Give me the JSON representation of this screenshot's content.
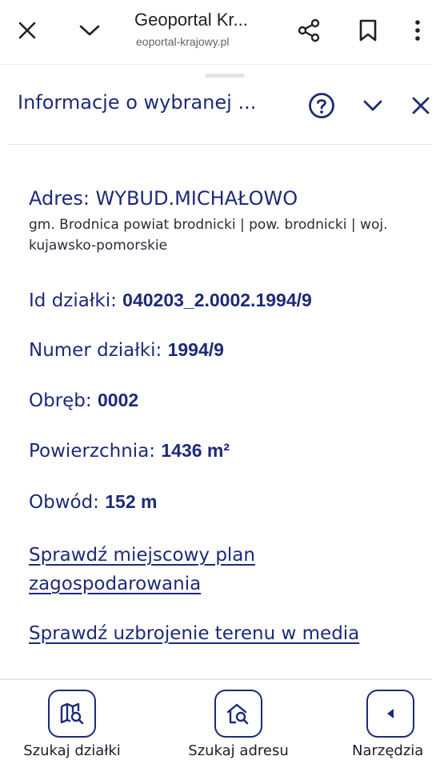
{
  "browser": {
    "title": "Geoportal Kr...",
    "url": "eoportal-krajowy.pl"
  },
  "panel": {
    "title": "Informacje o wybranej ..."
  },
  "parcel": {
    "address_label": "Adres: WYBUD.MICHAŁOWO",
    "address_detail": "gm. Brodnica powiat brodnicki | pow. brodnicki | woj. kujawsko-pomorskie",
    "fields": [
      {
        "label": "Id działki:",
        "value": "040203_2.0002.1994/9"
      },
      {
        "label": "Numer działki:",
        "value": "1994/9"
      },
      {
        "label": "Obręb:",
        "value": "0002"
      },
      {
        "label": "Powierzchnia:",
        "value": "1436 m²"
      },
      {
        "label": "Obwód:",
        "value": "152 m"
      }
    ],
    "links": [
      "Sprawdź miejscowy plan zagospodarowania",
      "Sprawdź uzbrojenie terenu w media"
    ]
  },
  "bottom_nav": [
    {
      "label": "Szukaj działki",
      "icon": "map-search-icon"
    },
    {
      "label": "Szukaj adresu",
      "icon": "home-search-icon"
    },
    {
      "label": "Narzędzia",
      "icon": "caret-left-icon"
    }
  ],
  "colors": {
    "accent": "#1e2a78"
  }
}
